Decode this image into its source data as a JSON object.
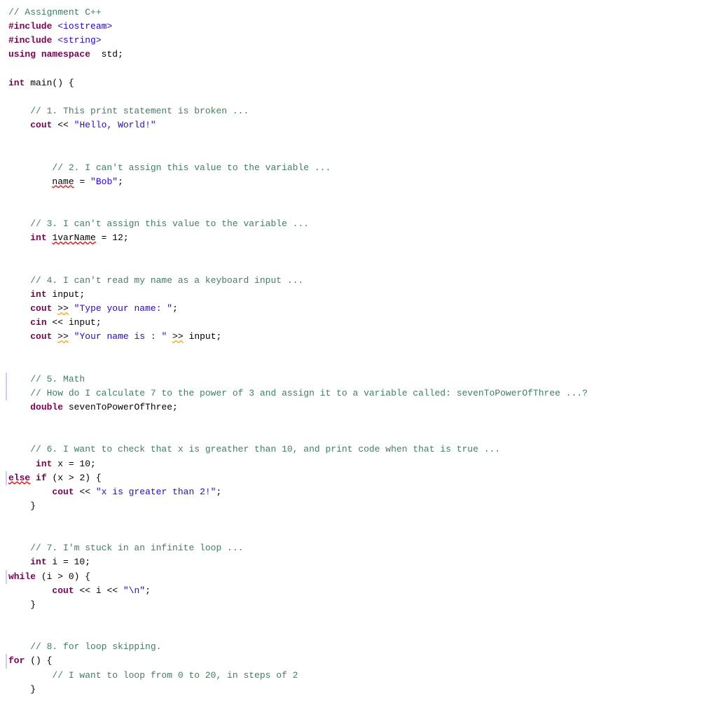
{
  "title": "Assignment C++",
  "lines": [
    {
      "id": "l1",
      "type": "comment",
      "text": "// Assignment C++"
    },
    {
      "id": "l2",
      "type": "preprocessor",
      "text": "#include <iostream>"
    },
    {
      "id": "l3",
      "type": "preprocessor",
      "text": "#include <string>"
    },
    {
      "id": "l4",
      "type": "normal",
      "text": "using namespace std;"
    },
    {
      "id": "l5",
      "type": "empty"
    },
    {
      "id": "l6",
      "type": "main_decl",
      "text": "int main() {"
    },
    {
      "id": "l7",
      "type": "empty"
    },
    {
      "id": "l8",
      "type": "comment_indent",
      "text": "    // 1. This print statement is broken ..."
    },
    {
      "id": "l9",
      "type": "code_indent",
      "text": "    cout << \"Hello, World!\""
    },
    {
      "id": "l10",
      "type": "empty"
    },
    {
      "id": "l11",
      "type": "empty"
    },
    {
      "id": "l12",
      "type": "comment_indent2",
      "text": "        // 2. I can't assign this value to the variable ..."
    },
    {
      "id": "l13",
      "type": "name_assign",
      "text": "        name = \"Bob\";"
    },
    {
      "id": "l14",
      "type": "empty"
    },
    {
      "id": "l15",
      "type": "empty"
    },
    {
      "id": "l16",
      "type": "comment_indent",
      "text": "    // 3. I can't assign this value to the variable ..."
    },
    {
      "id": "l17",
      "type": "int_lvar",
      "text": "    int 1varName = 12;"
    },
    {
      "id": "l18",
      "type": "empty"
    },
    {
      "id": "l19",
      "type": "empty"
    },
    {
      "id": "l20",
      "type": "comment_indent",
      "text": "    // 4. I can't read my name as a keyboard input ..."
    },
    {
      "id": "l21",
      "type": "int_input",
      "text": "    int input;"
    },
    {
      "id": "l22",
      "type": "cout_type",
      "text": "    cout >> \"Type your name: \";"
    },
    {
      "id": "l23",
      "type": "cin_line",
      "text": "    cin << input;"
    },
    {
      "id": "l24",
      "type": "cout_your",
      "text": "    cout >> \"Your name is : \" >> input;"
    },
    {
      "id": "l25",
      "type": "empty"
    },
    {
      "id": "l26",
      "type": "empty"
    },
    {
      "id": "l27",
      "type": "comment_bar",
      "text": "    // 5. Math"
    },
    {
      "id": "l28",
      "type": "comment_bar2",
      "text": "    // How do I calculate 7 to the power of 3 and assign it to a variable called: sevenToPowerOfThree ...?"
    },
    {
      "id": "l29",
      "type": "double_line",
      "text": "    double sevenToPowerOfThree;"
    },
    {
      "id": "l30",
      "type": "empty"
    },
    {
      "id": "l31",
      "type": "empty"
    },
    {
      "id": "l32",
      "type": "comment_indent",
      "text": "    // 6. I want to check that x is greather than 10, and print code when that is true ..."
    },
    {
      "id": "l33",
      "type": "int_x",
      "text": "     int x = 10;"
    },
    {
      "id": "l34",
      "type": "else_if_bar",
      "text": "else if (x > 2) {"
    },
    {
      "id": "l35",
      "type": "cout_x",
      "text": "        cout << \"x is greater than 2!\";"
    },
    {
      "id": "l36",
      "type": "brace_close",
      "text": "    }"
    },
    {
      "id": "l37",
      "type": "empty"
    },
    {
      "id": "l38",
      "type": "empty"
    },
    {
      "id": "l39",
      "type": "comment_indent",
      "text": "    // 7. I'm stuck in an infinite loop ..."
    },
    {
      "id": "l40",
      "type": "int_i",
      "text": "    int i = 10;"
    },
    {
      "id": "l41",
      "type": "while_bar",
      "text": "while (i > 0) {"
    },
    {
      "id": "l42",
      "type": "cout_i",
      "text": "        cout << i << \"\\n\";"
    },
    {
      "id": "l43",
      "type": "brace_close2",
      "text": "    }"
    },
    {
      "id": "l44",
      "type": "empty"
    },
    {
      "id": "l45",
      "type": "empty"
    },
    {
      "id": "l46",
      "type": "comment_indent",
      "text": "    // 8. for loop skipping."
    },
    {
      "id": "l47",
      "type": "for_bar",
      "text": "for () {"
    },
    {
      "id": "l48",
      "type": "comment_for",
      "text": "        // I want to loop from 0 to 20, in steps of 2"
    },
    {
      "id": "l49",
      "type": "brace_close3",
      "text": "    }"
    }
  ]
}
